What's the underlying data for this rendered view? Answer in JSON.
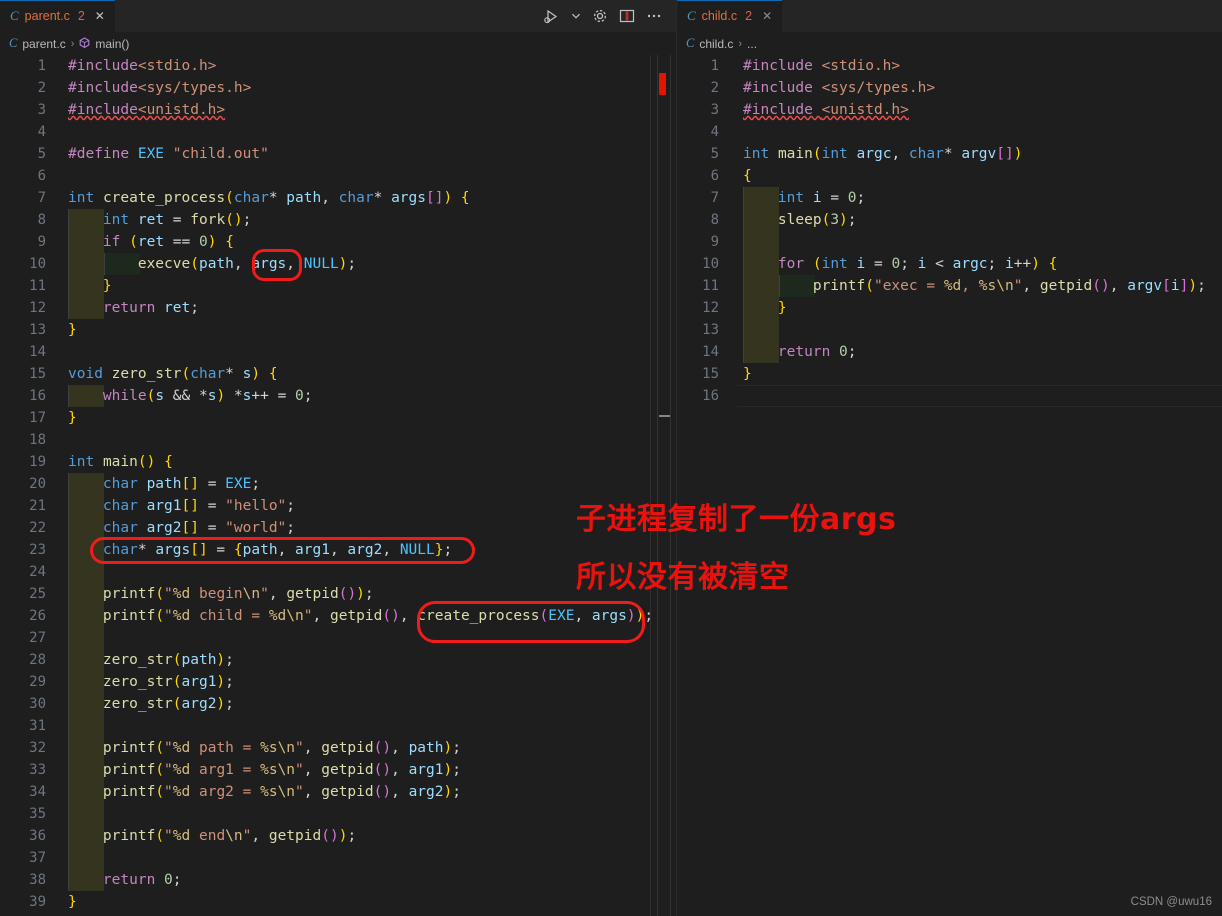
{
  "theme": {
    "editor_bg": "#1e1e1e",
    "tabbar_bg": "#252526",
    "line_number": "#6e7681",
    "annotation_red": "#f01c1c",
    "annotation_text_red": "#e8120f",
    "indent_level1_bg": "#35351f",
    "indent_level2_bg": "#1e291e",
    "error_marker": "#e51400"
  },
  "left_group": {
    "tab": {
      "file_icon": "c-file-icon",
      "icon_letter": "C",
      "name": "parent.c",
      "problem_count": "2",
      "close_glyph": "✕"
    },
    "actions": [
      {
        "name": "run-and-debug-icon",
        "label": "Run or Debug"
      },
      {
        "name": "chevron-down-icon",
        "label": "More run options"
      },
      {
        "name": "gear-icon",
        "label": "Settings"
      },
      {
        "name": "split-editor-icon",
        "label": "Split Editor"
      },
      {
        "name": "more-actions-icon",
        "label": "More Actions..."
      }
    ],
    "breadcrumb": {
      "icon_letter": "C",
      "file": "parent.c",
      "separator": "›",
      "symbol": "main()"
    },
    "line_count": 39,
    "lines": [
      {
        "n": 1,
        "indent": 0,
        "text": "#include<stdio.h>"
      },
      {
        "n": 2,
        "indent": 0,
        "text": "#include<sys/types.h>"
      },
      {
        "n": 3,
        "indent": 0,
        "text": "#include<unistd.h>"
      },
      {
        "n": 4,
        "indent": 0,
        "text": ""
      },
      {
        "n": 5,
        "indent": 0,
        "text": "#define EXE \"child.out\""
      },
      {
        "n": 6,
        "indent": 0,
        "text": ""
      },
      {
        "n": 7,
        "indent": 0,
        "text": "int create_process(char* path, char* args[]) {"
      },
      {
        "n": 8,
        "indent": 1,
        "text": "    int ret = fork();"
      },
      {
        "n": 9,
        "indent": 1,
        "text": "    if (ret == 0) {"
      },
      {
        "n": 10,
        "indent": 2,
        "text": "        execve(path, args, NULL);"
      },
      {
        "n": 11,
        "indent": 1,
        "text": "    }"
      },
      {
        "n": 12,
        "indent": 1,
        "text": "    return ret;"
      },
      {
        "n": 13,
        "indent": 0,
        "text": "}"
      },
      {
        "n": 14,
        "indent": 0,
        "text": ""
      },
      {
        "n": 15,
        "indent": 0,
        "text": "void zero_str(char* s) {"
      },
      {
        "n": 16,
        "indent": 1,
        "text": "    while(s && *s) *s++ = 0;"
      },
      {
        "n": 17,
        "indent": 0,
        "text": "}"
      },
      {
        "n": 18,
        "indent": 0,
        "text": ""
      },
      {
        "n": 19,
        "indent": 0,
        "text": "int main() {"
      },
      {
        "n": 20,
        "indent": 1,
        "text": "    char path[] = EXE;"
      },
      {
        "n": 21,
        "indent": 1,
        "text": "    char arg1[] = \"hello\";"
      },
      {
        "n": 22,
        "indent": 1,
        "text": "    char arg2[] = \"world\";"
      },
      {
        "n": 23,
        "indent": 1,
        "text": "    char* args[] = {path, arg1, arg2, NULL};"
      },
      {
        "n": 24,
        "indent": 1,
        "text": ""
      },
      {
        "n": 25,
        "indent": 1,
        "text": "    printf(\"%d begin\\n\", getpid());"
      },
      {
        "n": 26,
        "indent": 1,
        "text": "    printf(\"%d child = %d\\n\", getpid(), create_process(EXE, args));"
      },
      {
        "n": 27,
        "indent": 1,
        "text": ""
      },
      {
        "n": 28,
        "indent": 1,
        "text": "    zero_str(path);"
      },
      {
        "n": 29,
        "indent": 1,
        "text": "    zero_str(arg1);"
      },
      {
        "n": 30,
        "indent": 1,
        "text": "    zero_str(arg2);"
      },
      {
        "n": 31,
        "indent": 1,
        "text": ""
      },
      {
        "n": 32,
        "indent": 1,
        "text": "    printf(\"%d path = %s\\n\", getpid(), path);"
      },
      {
        "n": 33,
        "indent": 1,
        "text": "    printf(\"%d arg1 = %s\\n\", getpid(), arg1);"
      },
      {
        "n": 34,
        "indent": 1,
        "text": "    printf(\"%d arg2 = %s\\n\", getpid(), arg2);"
      },
      {
        "n": 35,
        "indent": 1,
        "text": ""
      },
      {
        "n": 36,
        "indent": 1,
        "text": "    printf(\"%d end\\n\", getpid());"
      },
      {
        "n": 37,
        "indent": 1,
        "text": ""
      },
      {
        "n": 38,
        "indent": 1,
        "text": "    return 0;"
      },
      {
        "n": 39,
        "indent": 0,
        "text": "}"
      }
    ]
  },
  "right_group": {
    "tab": {
      "file_icon": "c-file-icon",
      "icon_letter": "C",
      "name": "child.c",
      "problem_count": "2",
      "close_glyph": "✕"
    },
    "breadcrumb": {
      "icon_letter": "C",
      "file": "child.c",
      "separator": "›",
      "symbol": "..."
    },
    "line_count": 16,
    "lines": [
      {
        "n": 1,
        "indent": 0,
        "text": "#include <stdio.h>"
      },
      {
        "n": 2,
        "indent": 0,
        "text": "#include <sys/types.h>"
      },
      {
        "n": 3,
        "indent": 0,
        "text": "#include <unistd.h>"
      },
      {
        "n": 4,
        "indent": 0,
        "text": ""
      },
      {
        "n": 5,
        "indent": 0,
        "text": "int main(int argc, char* argv[])"
      },
      {
        "n": 6,
        "indent": 0,
        "text": "{"
      },
      {
        "n": 7,
        "indent": 1,
        "text": "    int i = 0;"
      },
      {
        "n": 8,
        "indent": 1,
        "text": "    sleep(3);"
      },
      {
        "n": 9,
        "indent": 1,
        "text": ""
      },
      {
        "n": 10,
        "indent": 1,
        "text": "    for (int i = 0; i < argc; i++) {"
      },
      {
        "n": 11,
        "indent": 2,
        "text": "        printf(\"exec = %d, %s\\n\", getpid(), argv[i]);"
      },
      {
        "n": 12,
        "indent": 1,
        "text": "    }"
      },
      {
        "n": 13,
        "indent": 1,
        "text": ""
      },
      {
        "n": 14,
        "indent": 1,
        "text": "    return 0;"
      },
      {
        "n": 15,
        "indent": 0,
        "text": "}"
      },
      {
        "n": 16,
        "indent": 0,
        "text": ""
      }
    ]
  },
  "annotations": {
    "boxes": [
      {
        "name": "annotation-box-args-execve",
        "target": "args,"
      },
      {
        "name": "annotation-box-args-declaration",
        "target": "char* args[] = {path, arg1, arg2, NULL};"
      },
      {
        "name": "annotation-box-create-process-call",
        "target": "create_process(EXE, args)"
      }
    ],
    "notes": [
      {
        "name": "annotation-note-line1",
        "text": "子进程复制了一份args"
      },
      {
        "name": "annotation-note-line2",
        "text": "所以没有被清空"
      }
    ]
  },
  "watermark": {
    "text": "CSDN @uwu16"
  }
}
